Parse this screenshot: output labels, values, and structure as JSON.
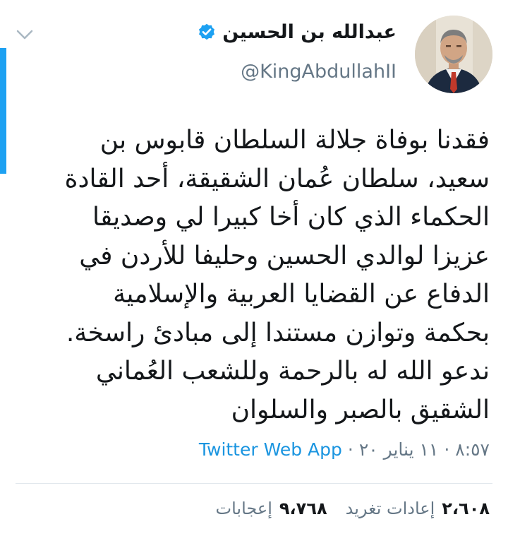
{
  "colors": {
    "accent": "#1da1f2",
    "link": "#1b95e0",
    "secondary_text": "#657786",
    "divider": "#e1e8ed"
  },
  "tweet": {
    "display_name": "عبدالله بن الحسين",
    "handle": "@KingAbdullahII",
    "verified": true,
    "lines": [
      "فقدنا بوفاة جلالة السلطان قابوس بن",
      "سعيد، سلطان عُمان الشقيقة، أحد القادة",
      "الحكماء الذي كان أخا كبيرا لي وصديقا",
      "عزيزا لوالدي الحسين وحليفا للأردن في",
      "الدفاع عن القضايا العربية والإسلامية",
      "بحكمة وتوازن مستندا إلى مبادئ راسخة.",
      "ندعو الله له بالرحمة وللشعب العُماني",
      "الشقيق بالصبر والسلوان"
    ],
    "time": "٨:٥٧",
    "date": "١١ يناير ٢٠",
    "separator": "·",
    "source": "Twitter Web App"
  },
  "stats": {
    "retweets_count": "٢،٦٠٨",
    "retweets_label": "إعادات تغريد",
    "likes_count": "٩،٧٦٨",
    "likes_label": "إعجابات"
  },
  "icons": {
    "menu": "chevron-down-icon",
    "verified": "verified-badge-icon"
  }
}
